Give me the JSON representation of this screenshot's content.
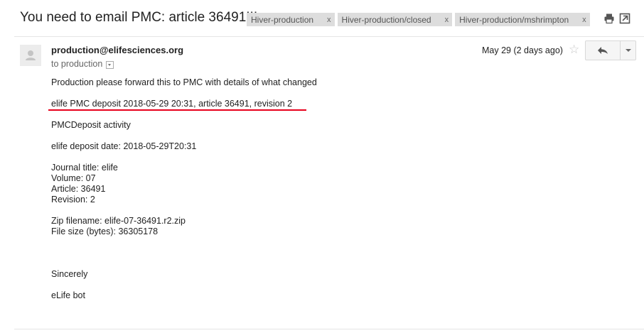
{
  "subject": "You need to email PMC: article 36491!!!",
  "labels": [
    {
      "name": "Hiver-production",
      "remove": "x"
    },
    {
      "name": "Hiver-production/closed",
      "remove": "x"
    },
    {
      "name": "Hiver-production/mshrimpton",
      "remove": "x"
    }
  ],
  "top_icons": [
    "print-icon",
    "new-window-icon"
  ],
  "message": {
    "sender": "production@elifesciences.org",
    "to_line": "to production",
    "date": "May 29 (2 days ago)",
    "star_icon": "star-icon",
    "reply_icon": "reply-icon",
    "more_icon": "chevron-down-icon",
    "body_lines": [
      "Production please forward this to PMC with details of what changed",
      "elife PMC deposit 2018-05-29 20:31, article 36491, revision 2",
      "PMCDeposit activity",
      "elife deposit date: 2018-05-29T20:31",
      "Journal title: elife",
      "Volume: 07",
      "Article: 36491",
      "Revision: 2",
      "Zip filename: elife-07-36491.r2.zip",
      "File size (bytes): 36305178",
      "Sincerely",
      "eLife bot"
    ]
  },
  "colors": {
    "underline": "#e8001c",
    "label_bg": "#dddddd"
  }
}
